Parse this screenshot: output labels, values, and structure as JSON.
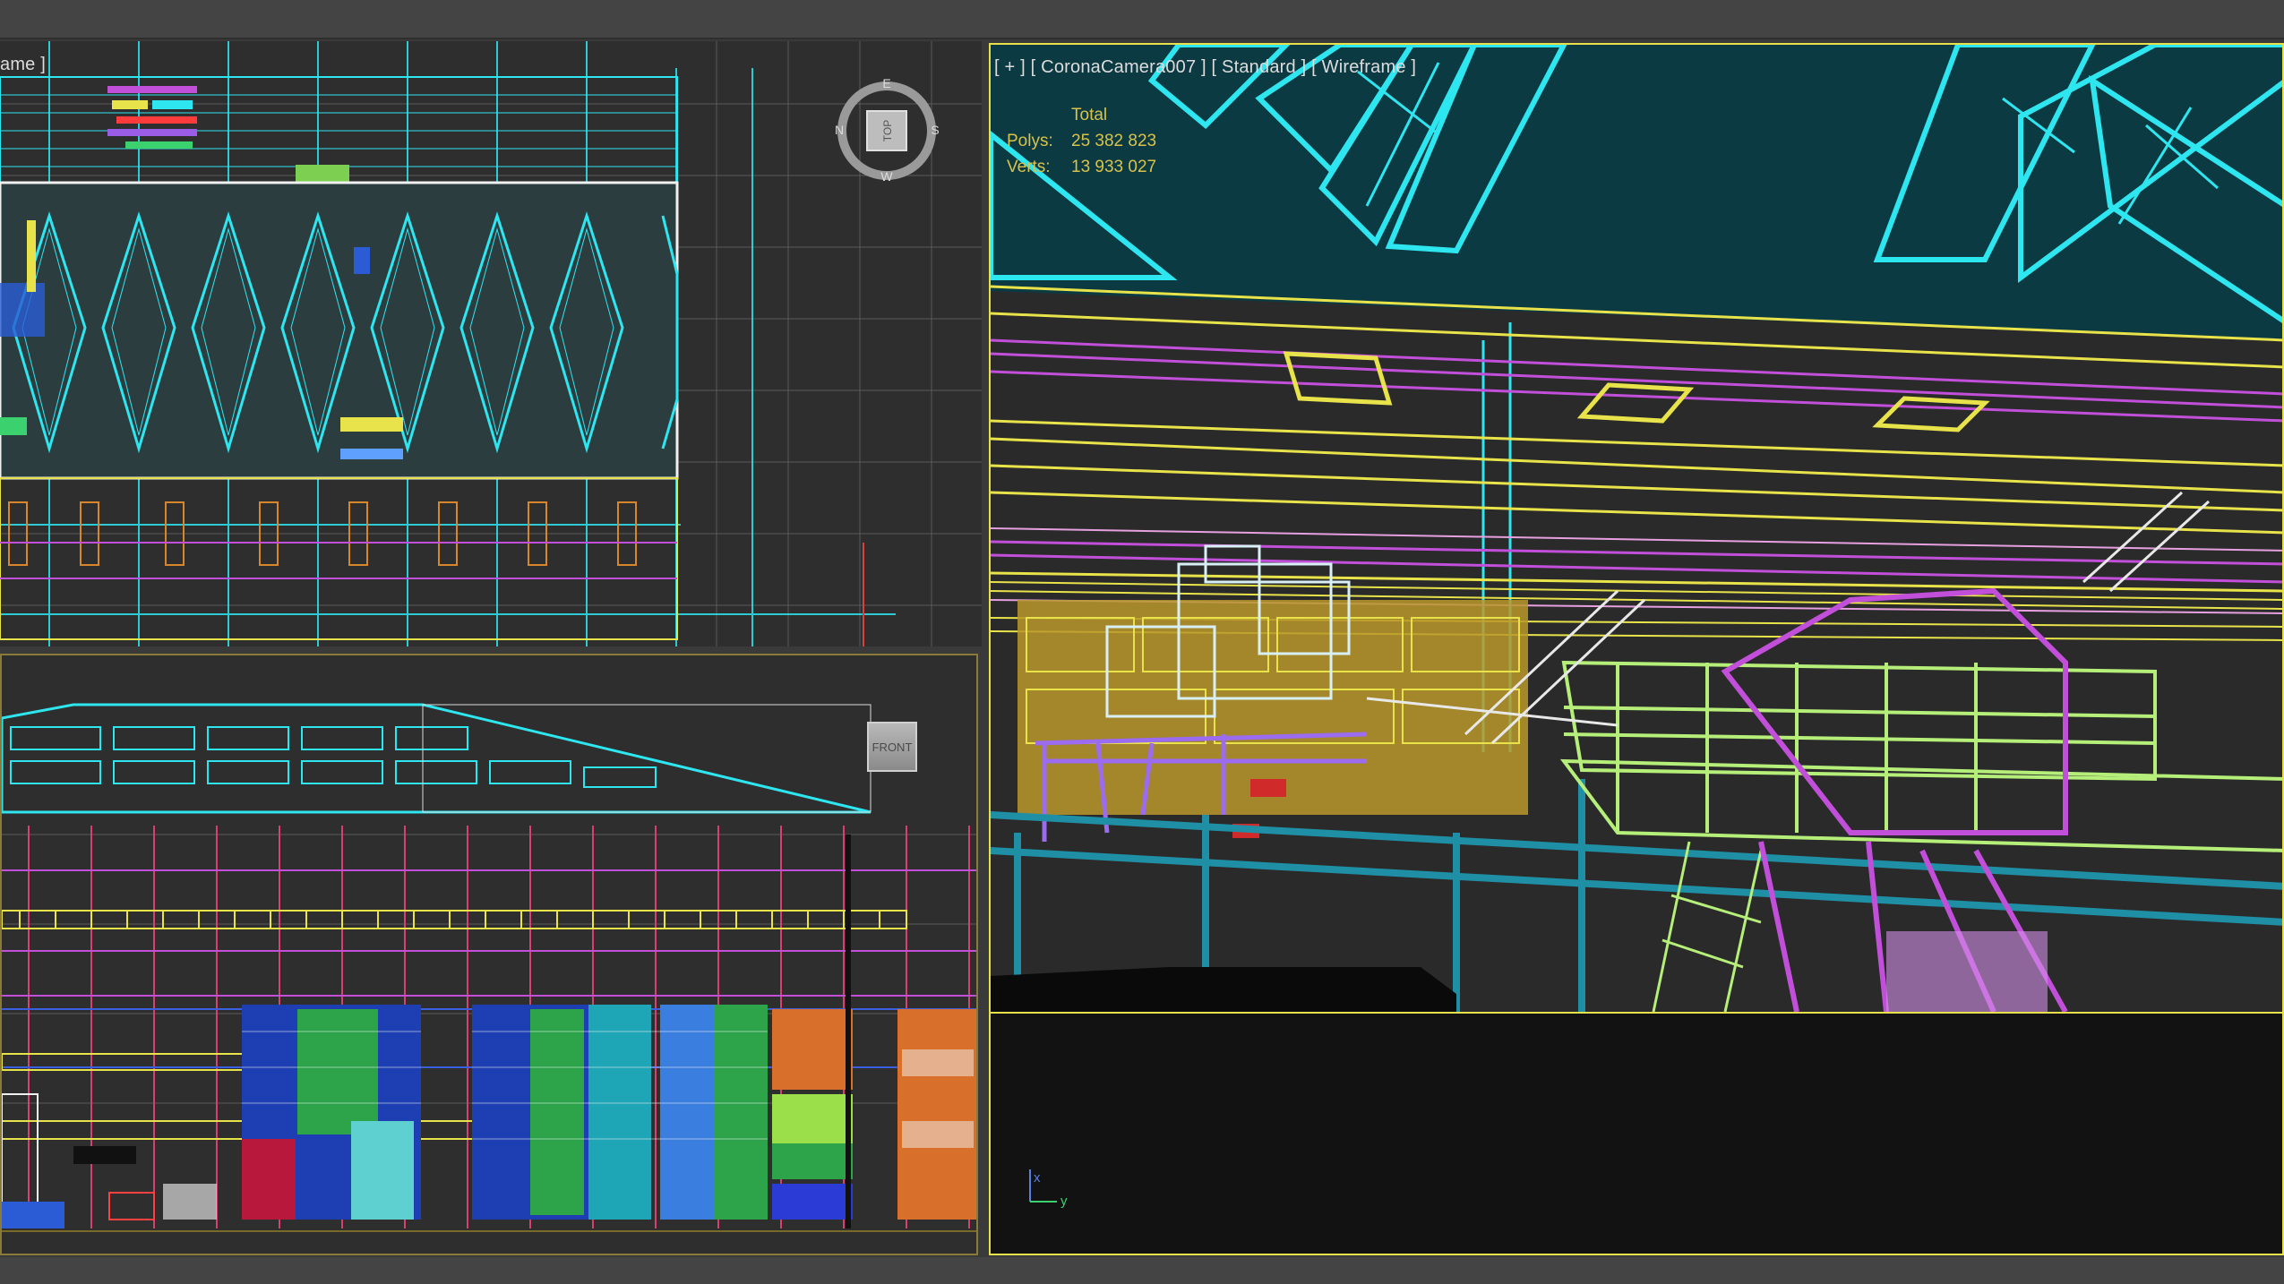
{
  "app": {
    "name": "3ds Max viewport layout"
  },
  "viewports": {
    "top": {
      "label": "ame ]",
      "view_cube": {
        "face": "TOP",
        "compass": [
          "E",
          "N",
          "S",
          "W"
        ]
      }
    },
    "front": {
      "view_cube": {
        "face": "FRONT"
      }
    },
    "camera": {
      "label": "[ + ] [ CoronaCamera007 ] [ Standard ] [ Wireframe ]",
      "stats": {
        "header": "Total",
        "polys_label": "Polys:",
        "polys_value": "25 382 823",
        "verts_label": "Verts:",
        "verts_value": "13 933 027"
      },
      "axis": {
        "x": "x",
        "y": "y"
      }
    }
  },
  "colors": {
    "background": "#3a3a3a",
    "viewport_bg": "#2b2b2b",
    "active_border": "#e6e04a",
    "inactive_border": "#8a7a3a",
    "wire_cyan": "#2ee6f0",
    "wire_yellow": "#e8e34a",
    "wire_magenta": "#c24fd9",
    "wire_lime": "#b6ee7a",
    "wire_orange": "#d8862b",
    "camera_sky": "#0c3a43"
  }
}
